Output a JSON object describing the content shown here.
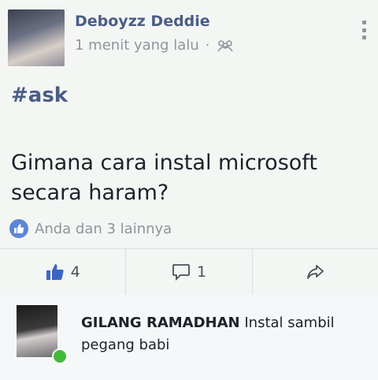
{
  "post": {
    "author": "Deboyzz Deddie",
    "time": "1 menit yang lalu",
    "separator": "·",
    "audience_icon": "group-icon",
    "hashtag": "#ask",
    "text": "Gimana cara instal microsoft secara haram?",
    "reactions_summary": "Anda dan 3 lainnya"
  },
  "actions": {
    "like_count": "4",
    "comment_count": "1"
  },
  "comment": {
    "author": "GILANG RAMADHAN",
    "text": "Instal sambil pegang babi"
  },
  "colors": {
    "name": "#4b5d86",
    "like_blue": "#5b86d7",
    "online_green": "#43b93a",
    "muted": "#90949c"
  }
}
